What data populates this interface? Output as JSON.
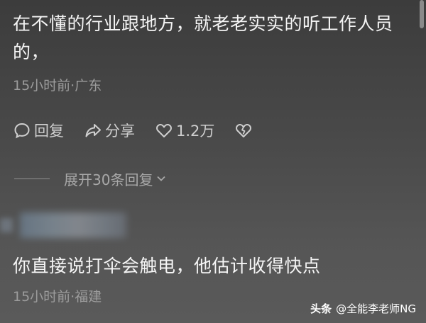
{
  "comments": [
    {
      "text": "在不懂的行业跟地方，就老老实实的听工作人员的，",
      "meta": "15小时前·广东",
      "actions": {
        "reply_label": "回复",
        "share_label": "分享",
        "like_count": "1.2万"
      },
      "expand_label": "展开30条回复"
    },
    {
      "text": "你直接说打伞会触电，他估计收得快点",
      "meta": "15小时前·福建"
    }
  ],
  "watermark": {
    "brand": "头条",
    "author": "@全能李老师NG"
  },
  "icons": {
    "reply": "comment-bubble-icon",
    "share": "share-arrow-icon",
    "like": "heart-icon",
    "dislike": "broken-heart-icon",
    "expand": "chevron-down-icon"
  }
}
